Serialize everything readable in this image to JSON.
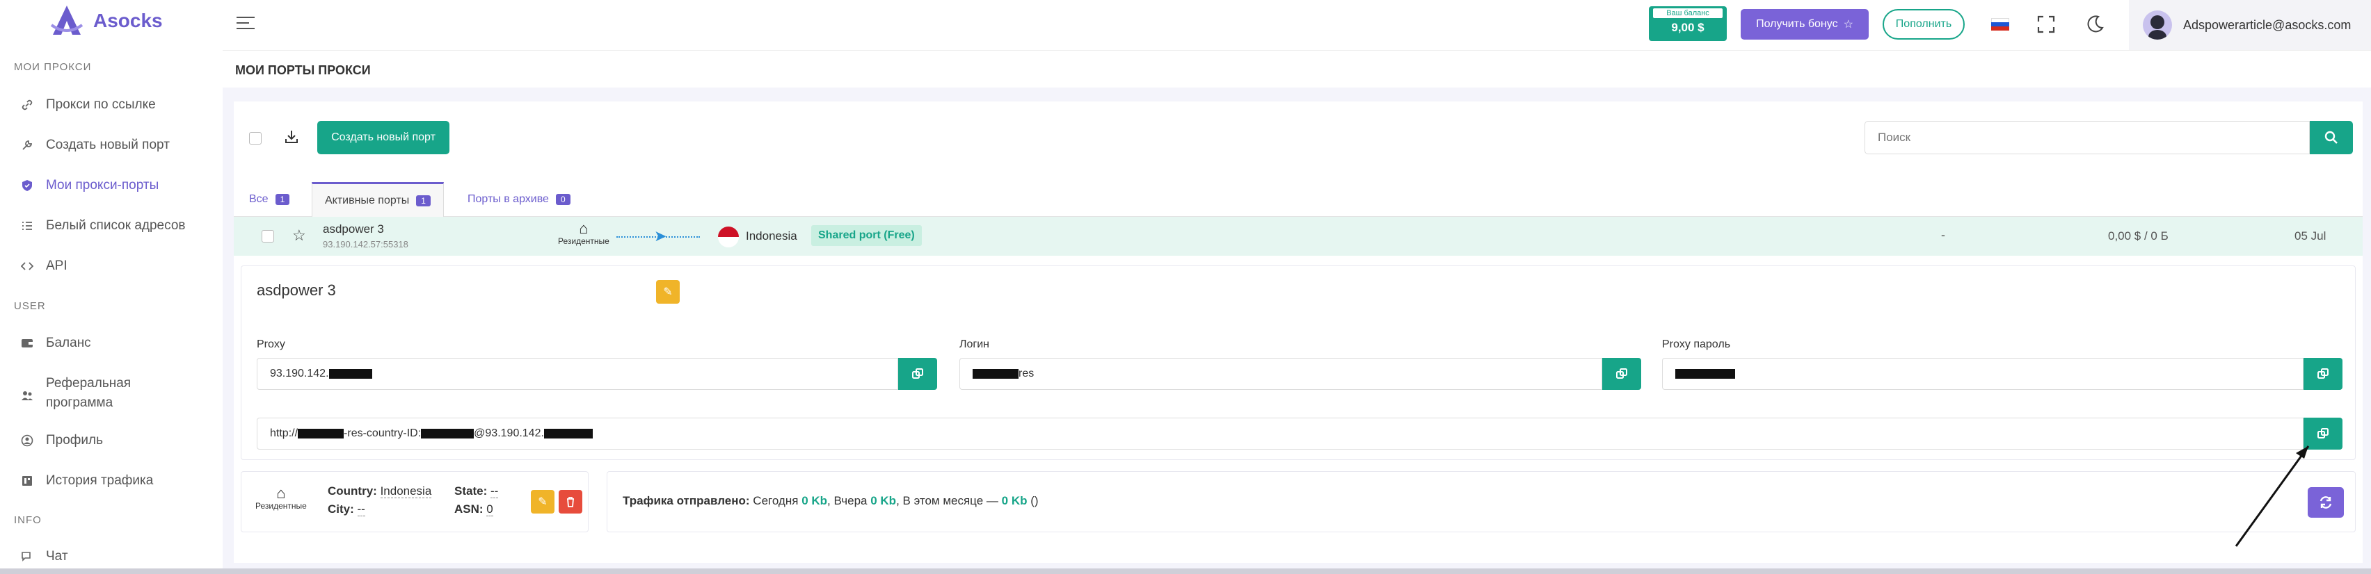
{
  "app": {
    "name": "Asocks"
  },
  "sidebar": {
    "section_proxies": "МОИ ПРОКСИ",
    "section_user": "USER",
    "section_info": "INFO",
    "items": [
      {
        "label": "Прокси по ссылке",
        "icon": "link-icon"
      },
      {
        "label": "Создать новый порт",
        "icon": "wrench-icon"
      },
      {
        "label": "Мои прокси-порты",
        "icon": "shield-icon",
        "active": true
      },
      {
        "label": "Белый список адресов",
        "icon": "list-icon"
      },
      {
        "label": "API",
        "icon": "code-icon"
      },
      {
        "label": "Баланс",
        "icon": "wallet-icon"
      },
      {
        "label": "Реферальная",
        "label2": "программа",
        "icon": "users-icon"
      },
      {
        "label": "Профиль",
        "icon": "user-circle-icon"
      },
      {
        "label": "История трафика",
        "icon": "history-icon"
      },
      {
        "label": "Чат",
        "icon": "chat-icon"
      }
    ]
  },
  "header": {
    "balance_label": "Ваш баланс",
    "balance_value": "9,00 $",
    "bonus_label": "Получить бонус",
    "topup_label": "Пополнить",
    "user_email": "Adspowerarticle@asocks.com"
  },
  "page": {
    "title": "МОИ ПОРТЫ ПРОКСИ"
  },
  "toolbar": {
    "create_label": "Создать новый порт",
    "search_placeholder": "Поиск"
  },
  "tabs": [
    {
      "label": "Все",
      "count": "1"
    },
    {
      "label": "Активные порты",
      "count": "1"
    },
    {
      "label": "Порты в архиве",
      "count": "0"
    }
  ],
  "port_row": {
    "name": "asdpower 3",
    "ip": "93.190.142.57:55318",
    "type_label": "Резидентные",
    "country": "Indonesia",
    "shared_label": "Shared port (Free)",
    "dash": "-",
    "traffic_cost": "0,00 $ / 0 Б",
    "date": "05 Jul"
  },
  "detail": {
    "title": "asdpower 3",
    "proxy_label": "Proxy",
    "proxy_value": "93.190.142.",
    "login_label": "Логин",
    "login_value": "res",
    "password_label": "Proxy пароль",
    "url_prefix": "http://",
    "url_part2": "-res-country-ID:",
    "url_part3": "@93.190.142."
  },
  "geo": {
    "type_label": "Резидентные",
    "country_key": "Country:",
    "country_val": "Indonesia",
    "city_key": "City:",
    "city_val": "--",
    "state_key": "State:",
    "state_val": "--",
    "asn_key": "ASN:",
    "asn_val": "0"
  },
  "traffic": {
    "label": "Трафика отправлено:",
    "today_key": "Сегодня",
    "today_val": "0 Kb",
    "yesterday_key": ", Вчера",
    "yesterday_val": "0 Kb",
    "month_key": ", В этом месяце —",
    "month_val": "0 Kb",
    "tail": "()"
  },
  "colors": {
    "accent": "#7a63d8",
    "teal": "#17a589",
    "row_bg": "#e6f6f1"
  }
}
